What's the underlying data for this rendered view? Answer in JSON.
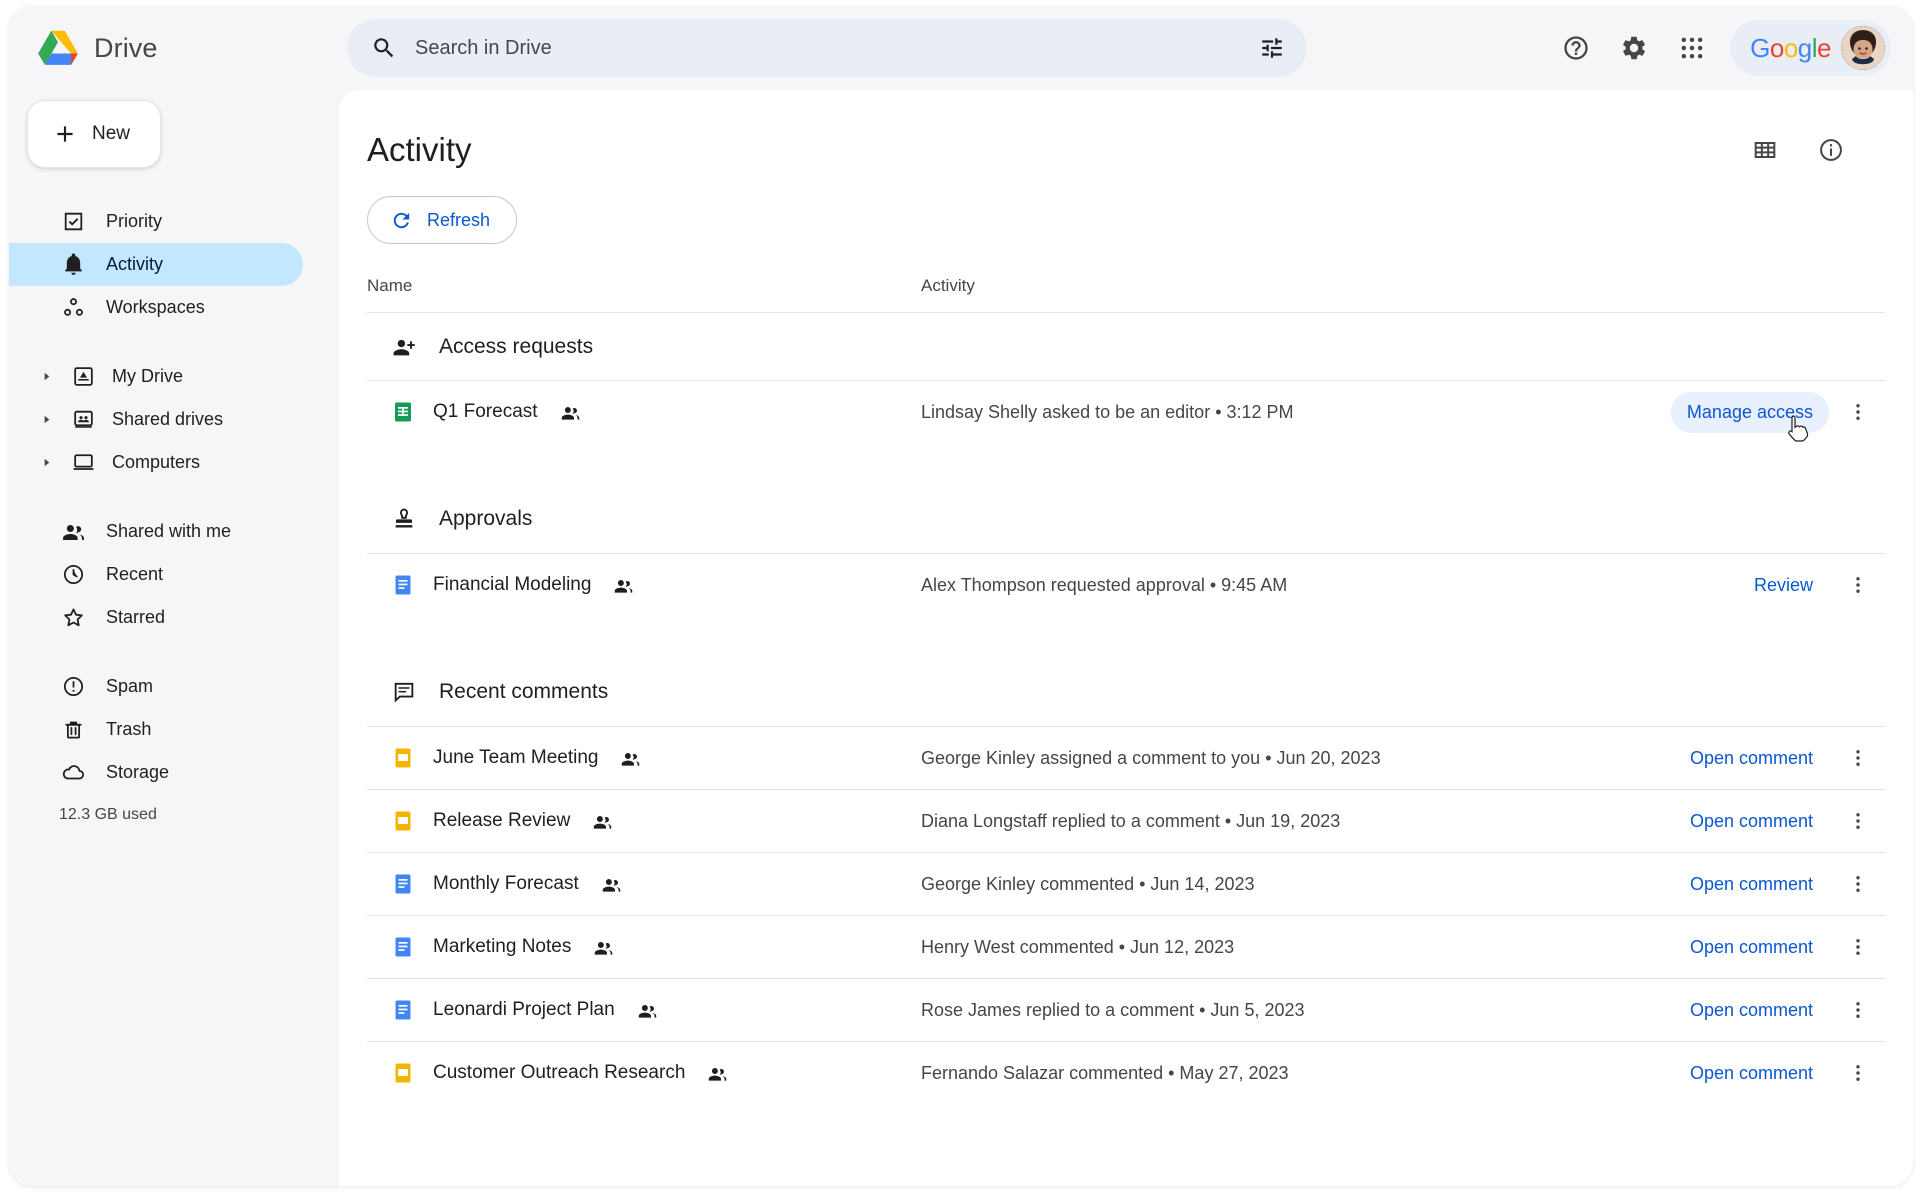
{
  "app": {
    "brand_name": "Drive",
    "logo_icon": "google-drive-logo"
  },
  "search": {
    "placeholder": "Search in Drive",
    "value": "",
    "search_icon": "search-icon",
    "filter_icon": "tune-filter-icon"
  },
  "topbar": {
    "help_icon": "help-circle-icon",
    "settings_icon": "gear-icon",
    "apps_icon": "apps-grid-icon",
    "google_word": "Google",
    "avatar_icon": "user-avatar"
  },
  "sidebar": {
    "new_button": {
      "label": "New",
      "icon": "plus-icon"
    },
    "groups": [
      {
        "items": [
          {
            "label": "Priority",
            "icon": "check-square-icon",
            "active": false,
            "caret": false
          },
          {
            "label": "Activity",
            "icon": "bell-icon",
            "active": true,
            "caret": false
          },
          {
            "label": "Workspaces",
            "icon": "workspaces-icon",
            "active": false,
            "caret": false
          }
        ]
      },
      {
        "items": [
          {
            "label": "My Drive",
            "icon": "my-drive-icon",
            "active": false,
            "caret": true
          },
          {
            "label": "Shared drives",
            "icon": "shared-drives-icon",
            "active": false,
            "caret": true
          },
          {
            "label": "Computers",
            "icon": "computer-icon",
            "active": false,
            "caret": true
          }
        ]
      },
      {
        "items": [
          {
            "label": "Shared with me",
            "icon": "people-icon",
            "active": false,
            "caret": false
          },
          {
            "label": "Recent",
            "icon": "clock-icon",
            "active": false,
            "caret": false
          },
          {
            "label": "Starred",
            "icon": "star-icon",
            "active": false,
            "caret": false
          }
        ]
      },
      {
        "items": [
          {
            "label": "Spam",
            "icon": "spam-icon",
            "active": false,
            "caret": false
          },
          {
            "label": "Trash",
            "icon": "trash-icon",
            "active": false,
            "caret": false
          },
          {
            "label": "Storage",
            "icon": "cloud-icon",
            "active": false,
            "caret": false
          }
        ]
      }
    ],
    "storage_used": "12.3 GB used"
  },
  "main": {
    "title": "Activity",
    "grid_view_icon": "grid-view-icon",
    "details_icon": "info-circle-icon",
    "refresh_button": {
      "label": "Refresh",
      "icon": "refresh-icon"
    },
    "columns": {
      "name": "Name",
      "activity": "Activity"
    },
    "sections": [
      {
        "id": "access-requests",
        "label": "Access requests",
        "icon": "person-add-icon",
        "rows": [
          {
            "file": "Q1 Forecast",
            "file_icon": "sheets-icon",
            "file_color": "#0f9d58",
            "shared_icon": "shared-people-icon",
            "activity": "Lindsay Shelly asked to be an editor • 3:12 PM",
            "action": "Manage access",
            "action_hovered": true,
            "kebab_icon": "more-vertical-icon"
          }
        ]
      },
      {
        "id": "approvals",
        "label": "Approvals",
        "icon": "approval-stamp-icon",
        "rows": [
          {
            "file": "Financial Modeling",
            "file_icon": "docs-icon",
            "file_color": "#4285f4",
            "shared_icon": "shared-people-icon",
            "activity": "Alex Thompson requested approval • 9:45 AM",
            "action": "Review",
            "action_hovered": false,
            "kebab_icon": "more-vertical-icon"
          }
        ]
      },
      {
        "id": "recent-comments",
        "label": "Recent comments",
        "icon": "comment-icon",
        "rows": [
          {
            "file": "June Team Meeting",
            "file_icon": "slides-icon",
            "file_color": "#f4b400",
            "shared_icon": "shared-people-icon",
            "activity": "George Kinley assigned a comment to you • Jun 20, 2023",
            "action": "Open comment",
            "action_hovered": false,
            "kebab_icon": "more-vertical-icon"
          },
          {
            "file": "Release Review",
            "file_icon": "slides-icon",
            "file_color": "#f4b400",
            "shared_icon": "shared-people-icon",
            "activity": "Diana Longstaff replied to a comment • Jun 19, 2023",
            "action": "Open comment",
            "action_hovered": false,
            "kebab_icon": "more-vertical-icon"
          },
          {
            "file": "Monthly Forecast",
            "file_icon": "docs-icon",
            "file_color": "#4285f4",
            "shared_icon": "shared-people-icon",
            "activity": "George Kinley commented • Jun 14, 2023",
            "action": "Open comment",
            "action_hovered": false,
            "kebab_icon": "more-vertical-icon"
          },
          {
            "file": "Marketing Notes",
            "file_icon": "docs-icon",
            "file_color": "#4285f4",
            "shared_icon": "shared-people-icon",
            "activity": "Henry West commented • Jun 12, 2023",
            "action": "Open comment",
            "action_hovered": false,
            "kebab_icon": "more-vertical-icon"
          },
          {
            "file": "Leonardi Project Plan",
            "file_icon": "docs-icon",
            "file_color": "#4285f4",
            "shared_icon": "shared-people-icon",
            "activity": "Rose James replied to a comment • Jun 5, 2023",
            "action": "Open comment",
            "action_hovered": false,
            "kebab_icon": "more-vertical-icon"
          },
          {
            "file": "Customer Outreach Research",
            "file_icon": "slides-icon",
            "file_color": "#f4b400",
            "shared_icon": "shared-people-icon",
            "activity": "Fernando Salazar commented • May 27, 2023",
            "action": "Open comment",
            "action_hovered": false,
            "kebab_icon": "more-vertical-icon"
          }
        ]
      }
    ]
  },
  "colors": {
    "accent_blue": "#0b57d0",
    "active_nav": "#c2e7ff",
    "search_bg": "#e9eef6",
    "sidebar_bg": "#f6f6f8",
    "sheets_green": "#0f9d58",
    "docs_blue": "#4285f4",
    "slides_yellow": "#f4b400"
  },
  "cursor": {
    "icon": "pointer-hand-cursor"
  }
}
